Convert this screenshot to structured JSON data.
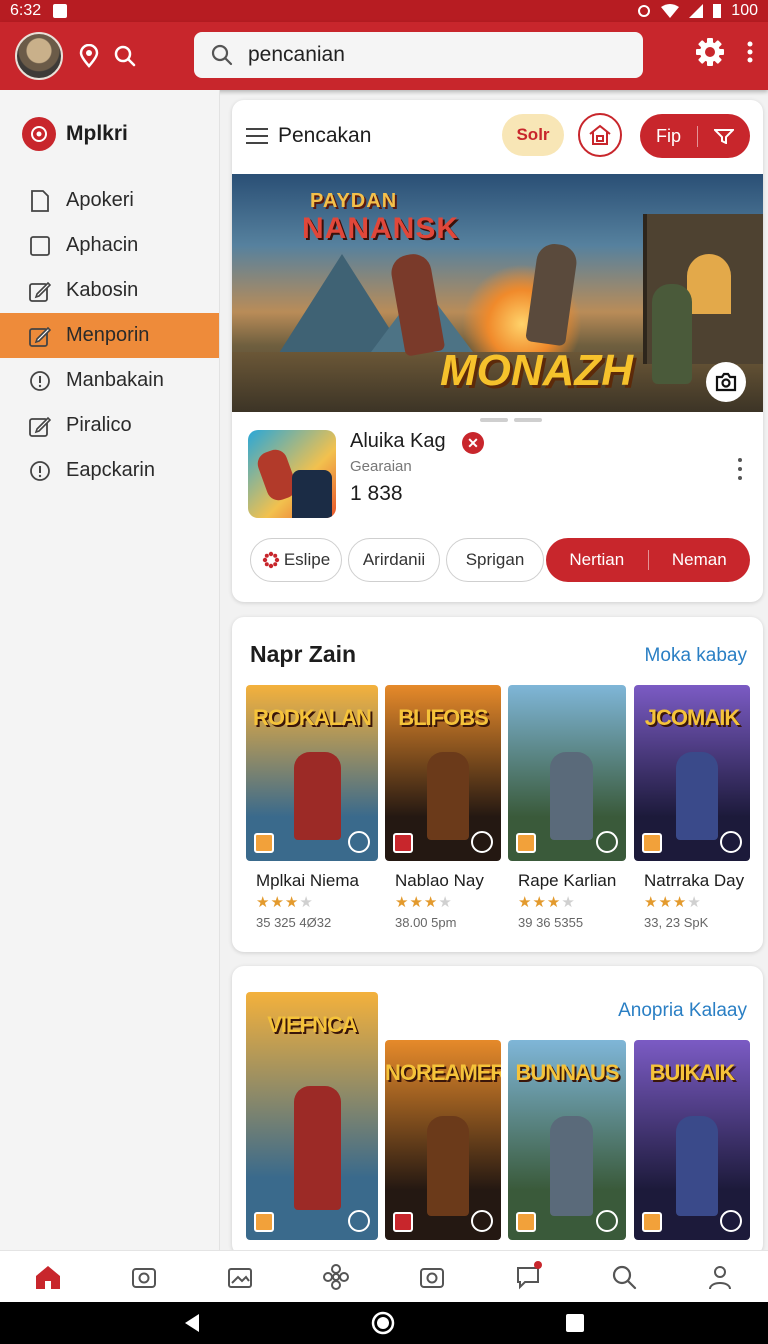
{
  "status_bar": {
    "time": "6:32",
    "battery": "100"
  },
  "app_bar": {
    "search_value": "pencanian",
    "icons": [
      "avatar",
      "location-pin-icon",
      "search-icon",
      "settings-gear-icon",
      "more-vert-icon"
    ]
  },
  "sidebar": {
    "brand": "Mplkri",
    "items": [
      {
        "label": "Apokeri",
        "icon": "document-icon",
        "active": false
      },
      {
        "label": "Aphacin",
        "icon": "square-icon",
        "active": false
      },
      {
        "label": "Kabosin",
        "icon": "edit-icon",
        "active": false
      },
      {
        "label": "Menporin",
        "icon": "edit-icon",
        "active": true
      },
      {
        "label": "Manbakain",
        "icon": "info-icon",
        "active": false
      },
      {
        "label": "Piralico",
        "icon": "edit-icon",
        "active": false
      },
      {
        "label": "Eapckarin",
        "icon": "info-icon",
        "active": false
      }
    ]
  },
  "featured": {
    "header_title": "Pencakan",
    "sort_label": "Solr",
    "filter_label": "Fip",
    "banner_text_top": "PAYDAN",
    "banner_text_mid": "NANANSK",
    "banner_text_main": "MONAZH",
    "app": {
      "name": "Aluika Kag",
      "developer": "Gearaian",
      "count": "1 838"
    },
    "chips": [
      "Eslipe",
      "Arirdanii",
      "Sprigan"
    ],
    "chip_actions": [
      "Nertian",
      "Neman"
    ]
  },
  "section1": {
    "title": "Napr Zain",
    "link": "Moka kabay",
    "games": [
      {
        "name": "Mplkai Niema",
        "rating": 3,
        "meta": "35 325 4Ø32",
        "label": "RODKALAN"
      },
      {
        "name": "Nablao  Nay",
        "rating": 3,
        "meta": "38.00 5pm",
        "label": "BLIFOBS"
      },
      {
        "name": "Rape Karlian",
        "rating": 3,
        "meta": "39 36 5355",
        "label": ""
      },
      {
        "name": "Natrraka  Day",
        "rating": 3,
        "meta": "33, 23 SpK",
        "label": "JCOMAIK"
      }
    ]
  },
  "section2": {
    "link": "Anopria Kalaay",
    "games": [
      {
        "label": "VIEFNCA"
      },
      {
        "label": "NOREAMER"
      },
      {
        "label": "BUNNAUS"
      },
      {
        "label": "BUIKAIK"
      }
    ]
  },
  "bottom_nav": {
    "icons": [
      "home-icon",
      "camera-icon",
      "gallery-icon",
      "flower-icon",
      "camera-icon-2",
      "chat-icon",
      "search-icon",
      "profile-icon"
    ]
  },
  "colors": {
    "accent": "#c8262c",
    "active_nav": "#ee8b3a",
    "link": "#2a7fc4"
  }
}
